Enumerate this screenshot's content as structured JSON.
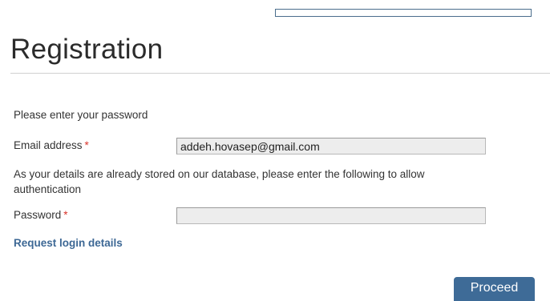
{
  "header": {
    "top_input_value": "",
    "title": "Registration"
  },
  "form": {
    "intro": "Please enter your password",
    "email_label": "Email address",
    "required_marker": "*",
    "email_value": "addeh.hovasep@gmail.com",
    "details_note": "As your details are already stored on our database, please enter the following to allow authentication",
    "password_label": "Password",
    "password_value": "",
    "request_login_link": "Request login details",
    "proceed_label": "Proceed"
  },
  "colors": {
    "link": "#3d6895",
    "button": "#3e6b97",
    "required": "#d9342b",
    "field_background": "#ededed"
  }
}
